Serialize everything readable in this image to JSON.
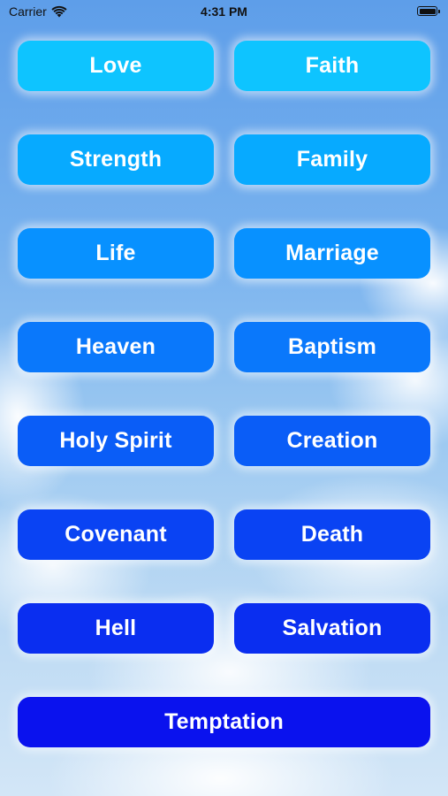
{
  "status_bar": {
    "carrier": "Carrier",
    "time": "4:31 PM",
    "icons": [
      "wifi-icon",
      "battery-icon"
    ]
  },
  "topics": {
    "love": "Love",
    "faith": "Faith",
    "strength": "Strength",
    "family": "Family",
    "life": "Life",
    "marriage": "Marriage",
    "heaven": "Heaven",
    "baptism": "Baptism",
    "holy_spirit": "Holy Spirit",
    "creation": "Creation",
    "covenant": "Covenant",
    "death": "Death",
    "hell": "Hell",
    "salvation": "Salvation",
    "temptation": "Temptation"
  },
  "colors": {
    "row1": "#0ec4ff",
    "row8": "#0a12ee",
    "button_text": "#ffffff"
  }
}
